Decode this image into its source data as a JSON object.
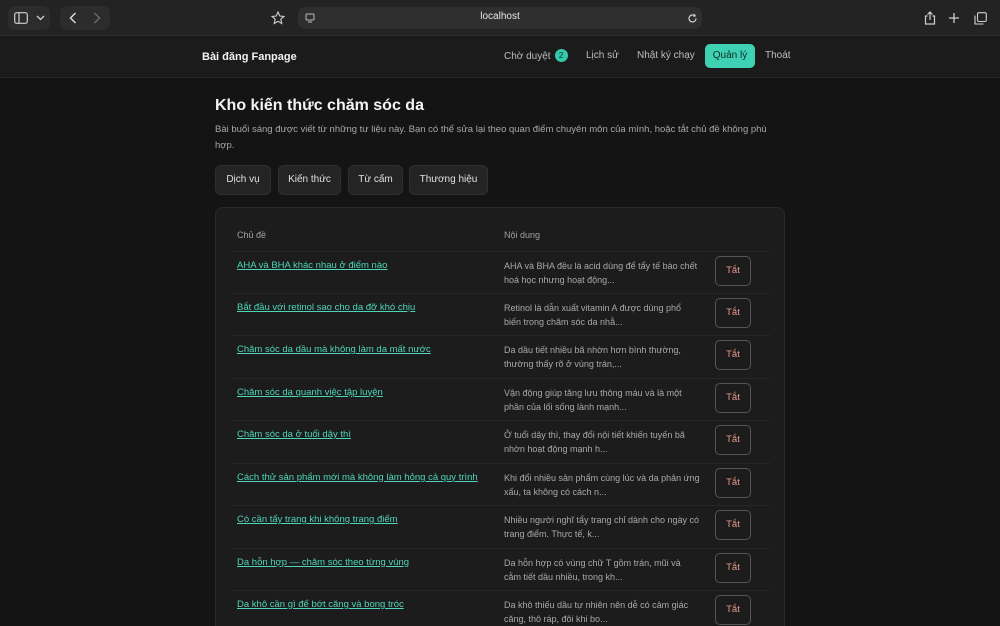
{
  "browser": {
    "url": "localhost"
  },
  "header": {
    "brand": "Bài đăng Fanpage",
    "nav": {
      "pending_label": "Chờ duyệt",
      "pending_count": "2",
      "history": "Lịch sử",
      "run_log": "Nhật ký chạy",
      "manage": "Quản lý",
      "logout": "Thoát"
    }
  },
  "page": {
    "title": "Kho kiến thức chăm sóc da",
    "description": "Bài buổi sáng được viết từ những tư liệu này. Bạn có thể sửa lại theo quan điểm chuyên môn của mình, hoặc tắt chủ đề không phù hợp."
  },
  "filters": [
    "Dịch vụ",
    "Kiến thức",
    "Từ cấm",
    "Thương hiệu"
  ],
  "table": {
    "col_topic": "Chủ đề",
    "col_content": "Nội dung",
    "off_label": "Tắt",
    "rows": [
      {
        "topic": "AHA và BHA khác nhau ở điểm nào",
        "content": "AHA và BHA đều là acid dùng để tẩy tế bào chết hoá học nhưng hoạt động..."
      },
      {
        "topic": "Bắt đầu với retinol sao cho da đỡ khó chịu",
        "content": "Retinol là dẫn xuất vitamin A được dùng phổ biến trong chăm sóc da nhằ..."
      },
      {
        "topic": "Chăm sóc da dầu mà không làm da mất nước",
        "content": "Da dầu tiết nhiều bã nhờn hơn bình thường, thường thấy rõ ở vùng trán,..."
      },
      {
        "topic": "Chăm sóc da quanh việc tập luyện",
        "content": "Vận động giúp tăng lưu thông máu và là một phần của lối sống lành mạnh..."
      },
      {
        "topic": "Chăm sóc da ở tuổi dậy thì",
        "content": "Ở tuổi dậy thì, thay đổi nội tiết khiến tuyến bã nhờn hoạt động mạnh h..."
      },
      {
        "topic": "Cách thử sản phẩm mới mà không làm hỏng cả quy trình",
        "content": "Khi đổi nhiều sản phẩm cùng lúc và da phản ứng xấu, ta không có cách n..."
      },
      {
        "topic": "Có cần tẩy trang khi không trang điểm",
        "content": "Nhiều người nghĩ tẩy trang chỉ dành cho ngày có trang điểm. Thực tế, k..."
      },
      {
        "topic": "Da hỗn hợp — chăm sóc theo từng vùng",
        "content": "Da hỗn hợp có vùng chữ T gồm trán, mũi và cằm tiết dầu nhiều, trong kh..."
      },
      {
        "topic": "Da khô cần gì để bớt căng và bong tróc",
        "content": "Da khô thiếu dầu tự nhiên nên dễ có cảm giác căng, thô ráp, đôi khi bo..."
      }
    ]
  }
}
